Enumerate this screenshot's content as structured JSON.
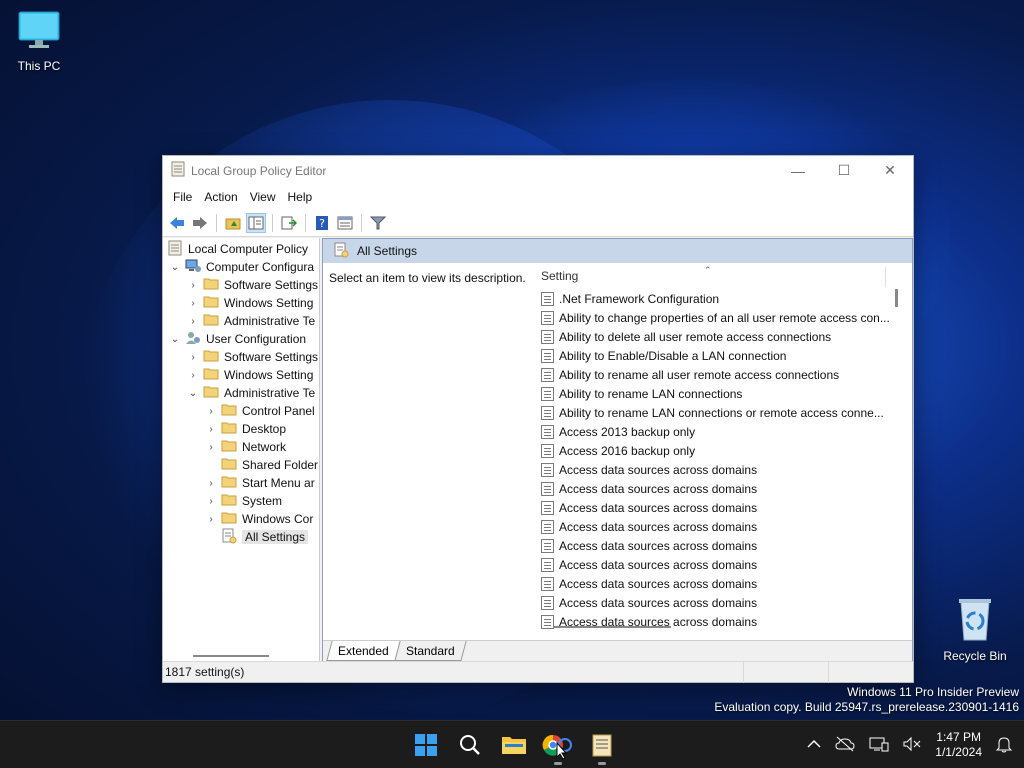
{
  "desktop": {
    "this_pc_label": "This PC",
    "recycle_bin_label": "Recycle Bin"
  },
  "window": {
    "title": "Local Group Policy Editor",
    "menu": [
      "File",
      "Action",
      "View",
      "Help"
    ],
    "tree": {
      "root": "Local Computer Policy",
      "computer_config": "Computer Configura",
      "cc_software": "Software Settings",
      "cc_windows": "Windows Setting",
      "cc_admin": "Administrative Te",
      "user_config": "User Configuration",
      "uc_software": "Software Settings",
      "uc_windows": "Windows Setting",
      "uc_admin": "Administrative Te",
      "control_panel": "Control Panel",
      "desktop": "Desktop",
      "network": "Network",
      "shared_folders": "Shared Folder",
      "start_menu": "Start Menu ar",
      "system": "System",
      "windows_components": "Windows Cor",
      "all_settings": "All Settings"
    },
    "panel_title": "All Settings",
    "description_text": "Select an item to view its description.",
    "column_header": "Setting",
    "settings": [
      ".Net Framework Configuration",
      "Ability to change properties of an all user remote access con...",
      "Ability to delete all user remote access connections",
      "Ability to Enable/Disable a LAN connection",
      "Ability to rename all user remote access connections",
      "Ability to rename LAN connections",
      "Ability to rename LAN connections or remote access conne...",
      "Access 2013 backup only",
      "Access 2016 backup only",
      "Access data sources across domains",
      "Access data sources across domains",
      "Access data sources across domains",
      "Access data sources across domains",
      "Access data sources across domains",
      "Access data sources across domains",
      "Access data sources across domains",
      "Access data sources across domains",
      "Access data sources across domains"
    ],
    "tabs": [
      "Extended",
      "Standard"
    ],
    "status_text": "1817 setting(s)"
  },
  "watermark": {
    "line1": "Windows 11 Pro Insider Preview",
    "line2": "Evaluation copy. Build 25947.rs_prerelease.230901-1416"
  },
  "taskbar": {
    "time": "1:47 PM",
    "date": "1/1/2024",
    "apps": [
      "start-icon",
      "search-icon",
      "file-explorer-icon",
      "chrome-icon",
      "notepad-icon"
    ]
  },
  "colors": {
    "panel_header": "#c8d6ea",
    "taskbar": "#1c1c1c",
    "wallpaper": "#0d2f8a"
  }
}
